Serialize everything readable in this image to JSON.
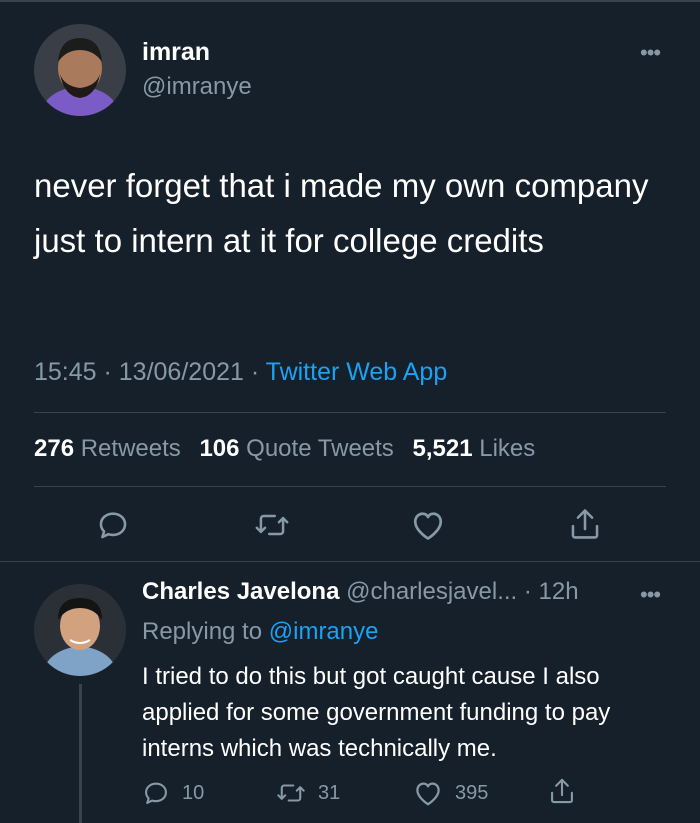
{
  "tweet": {
    "author_name": "imran",
    "author_handle": "@imranye",
    "text": "never forget that i made my own company just to intern at it for college credits",
    "time": "15:45 · 13/06/2021 ·",
    "source": "Twitter Web App",
    "stats": {
      "retweets_count": "276",
      "retweets_label": "Retweets",
      "quotes_count": "106",
      "quotes_label": "Quote Tweets",
      "likes_count": "5,521",
      "likes_label": "Likes"
    },
    "more_label": "•••"
  },
  "reply": {
    "author_name": "Charles Javelona",
    "author_handle": "@charlesjavel...",
    "age": "· 12h",
    "replying_prefix": "Replying to",
    "replying_to": "@imranye",
    "text": "I tried to do this but got caught cause I also applied for some government funding to pay interns which was technically me.",
    "reply_count": "10",
    "retweet_count": "31",
    "like_count": "395",
    "more_label": "•••"
  },
  "icons": {
    "reply": "reply-icon",
    "retweet": "retweet-icon",
    "like": "heart-icon",
    "share": "share-icon"
  },
  "colors": {
    "background": "#15202b",
    "secondary_text": "#8899a6",
    "link": "#1da1f2",
    "divider": "#38444d"
  }
}
